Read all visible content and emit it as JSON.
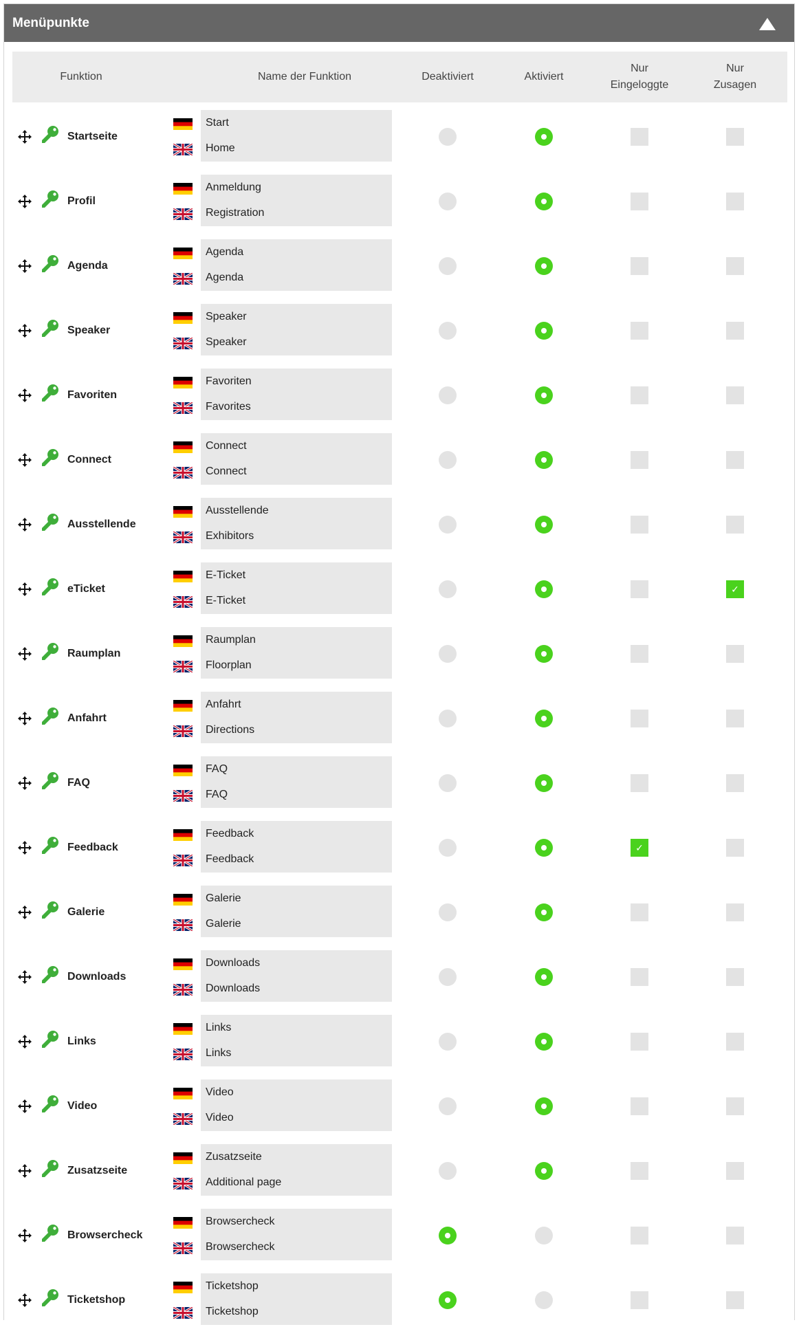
{
  "panel": {
    "title": "Menüpunkte",
    "collapse_icon": "triangle-up-icon"
  },
  "table": {
    "headers": {
      "funktion": "Funktion",
      "name": "Name der Funktion",
      "deaktiviert": "Deaktiviert",
      "aktiviert": "Aktiviert",
      "nur_eingeloggte_1": "Nur",
      "nur_eingeloggte_2": "Eingeloggte",
      "nur_zusagen_1": "Nur",
      "nur_zusagen_2": "Zusagen"
    },
    "rows": [
      {
        "func": "Startseite",
        "de": "Start",
        "en": "Home",
        "status": "aktiviert",
        "nur_eingeloggte": false,
        "nur_zusagen": false
      },
      {
        "func": "Profil",
        "de": "Anmeldung",
        "en": "Registration",
        "status": "aktiviert",
        "nur_eingeloggte": false,
        "nur_zusagen": false
      },
      {
        "func": "Agenda",
        "de": "Agenda",
        "en": "Agenda",
        "status": "aktiviert",
        "nur_eingeloggte": false,
        "nur_zusagen": false
      },
      {
        "func": "Speaker",
        "de": "Speaker",
        "en": "Speaker",
        "status": "aktiviert",
        "nur_eingeloggte": false,
        "nur_zusagen": false
      },
      {
        "func": "Favoriten",
        "de": "Favoriten",
        "en": "Favorites",
        "status": "aktiviert",
        "nur_eingeloggte": false,
        "nur_zusagen": false
      },
      {
        "func": "Connect",
        "de": "Connect",
        "en": "Connect",
        "status": "aktiviert",
        "nur_eingeloggte": false,
        "nur_zusagen": false
      },
      {
        "func": "Ausstellende",
        "de": "Ausstellende",
        "en": "Exhibitors",
        "status": "aktiviert",
        "nur_eingeloggte": false,
        "nur_zusagen": false
      },
      {
        "func": "eTicket",
        "de": "E-Ticket",
        "en": "E-Ticket",
        "status": "aktiviert",
        "nur_eingeloggte": false,
        "nur_zusagen": true
      },
      {
        "func": "Raumplan",
        "de": "Raumplan",
        "en": "Floorplan",
        "status": "aktiviert",
        "nur_eingeloggte": false,
        "nur_zusagen": false
      },
      {
        "func": "Anfahrt",
        "de": "Anfahrt",
        "en": "Directions",
        "status": "aktiviert",
        "nur_eingeloggte": false,
        "nur_zusagen": false
      },
      {
        "func": "FAQ",
        "de": "FAQ",
        "en": "FAQ",
        "status": "aktiviert",
        "nur_eingeloggte": false,
        "nur_zusagen": false
      },
      {
        "func": "Feedback",
        "de": "Feedback",
        "en": "Feedback",
        "status": "aktiviert",
        "nur_eingeloggte": true,
        "nur_zusagen": false
      },
      {
        "func": "Galerie",
        "de": "Galerie",
        "en": "Galerie",
        "status": "aktiviert",
        "nur_eingeloggte": false,
        "nur_zusagen": false
      },
      {
        "func": "Downloads",
        "de": "Downloads",
        "en": "Downloads",
        "status": "aktiviert",
        "nur_eingeloggte": false,
        "nur_zusagen": false
      },
      {
        "func": "Links",
        "de": "Links",
        "en": "Links",
        "status": "aktiviert",
        "nur_eingeloggte": false,
        "nur_zusagen": false
      },
      {
        "func": "Video",
        "de": "Video",
        "en": "Video",
        "status": "aktiviert",
        "nur_eingeloggte": false,
        "nur_zusagen": false
      },
      {
        "func": "Zusatzseite",
        "de": "Zusatzseite",
        "en": "Additional page",
        "status": "aktiviert",
        "nur_eingeloggte": false,
        "nur_zusagen": false
      },
      {
        "func": "Browsercheck",
        "de": "Browsercheck",
        "en": "Browsercheck",
        "status": "deaktiviert",
        "nur_eingeloggte": false,
        "nur_zusagen": false
      },
      {
        "func": "Ticketshop",
        "de": "Ticketshop",
        "en": "Ticketshop",
        "status": "deaktiviert",
        "nur_eingeloggte": false,
        "nur_zusagen": false
      }
    ]
  },
  "icons": {
    "drag": "move-arrows-icon",
    "key": "key-icon",
    "flag_de": "flag-germany-icon",
    "flag_en": "flag-uk-icon",
    "check": "checkmark-icon"
  },
  "colors": {
    "header_bg": "#666666",
    "accent_green": "#4ad21d",
    "key_green": "#3fae3a",
    "control_grey": "#e3e3e3",
    "field_grey": "#e8e8e8",
    "thead_bg": "#ececec"
  },
  "symbols": {
    "check": "✓"
  }
}
